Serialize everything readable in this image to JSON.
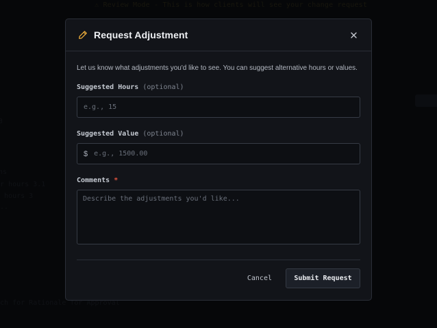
{
  "background": {
    "banner": "⚠ Review Mode - This is how clients will see your change request",
    "fragments": [
      "3",
      "hs",
      "or hours 3.1",
      "k hours 3",
      "...",
      "ouch for Rationale for Approval"
    ]
  },
  "modal": {
    "title": "Request Adjustment",
    "intro": "Let us know what adjustments you'd like to see. You can suggest alternative hours or values.",
    "fields": {
      "hours": {
        "label": "Suggested Hours",
        "optional": "(optional)",
        "placeholder": "e.g., 15"
      },
      "value": {
        "label": "Suggested Value",
        "optional": "(optional)",
        "prefix": "$",
        "placeholder": "e.g., 1500.00"
      },
      "comments": {
        "label": "Comments",
        "required": "*",
        "placeholder": "Describe the adjustments you'd like..."
      }
    },
    "buttons": {
      "cancel": "Cancel",
      "submit": "Submit Request"
    }
  },
  "colors": {
    "accent_icon": "#e7a93a",
    "required": "#e0533f",
    "modal_bg": "#121419"
  }
}
